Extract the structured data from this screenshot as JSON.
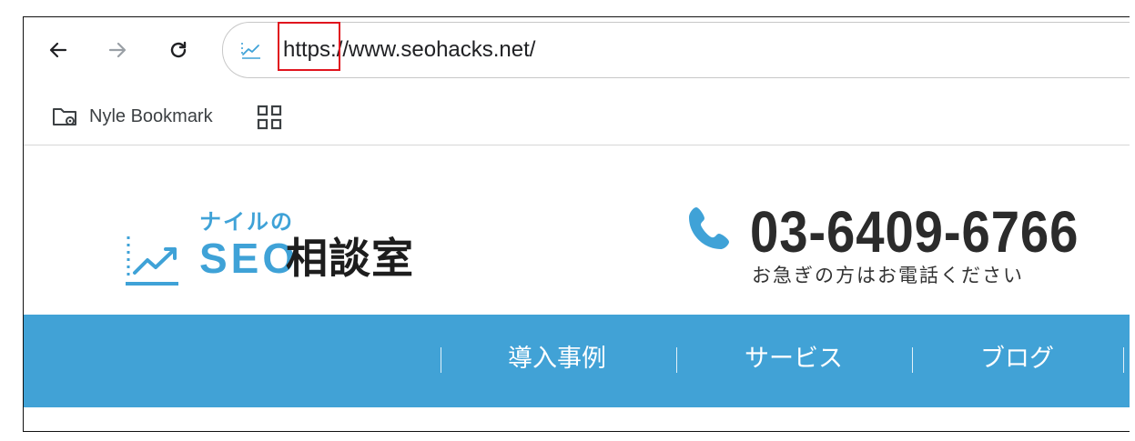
{
  "browser": {
    "url": "https://www.seohacks.net/",
    "bookmarks_bar": {
      "folder_label": "Nyle Bookmark"
    }
  },
  "site": {
    "logo": {
      "tagline": "ナイルの",
      "brand": "SEO",
      "title": "相談室"
    },
    "contact": {
      "phone": "03-6409-6766",
      "note": "お急ぎの方はお電話ください"
    },
    "nav": {
      "items": [
        "導入事例",
        "サービス",
        "ブログ"
      ]
    }
  },
  "colors": {
    "brand_blue": "#41a2d6",
    "highlight_red": "#e0141e"
  },
  "icons": [
    "back-arrow-icon",
    "forward-arrow-icon",
    "reload-icon",
    "site-info-icon",
    "folder-gear-icon",
    "apps-grid-icon",
    "chart-icon",
    "phone-icon"
  ]
}
